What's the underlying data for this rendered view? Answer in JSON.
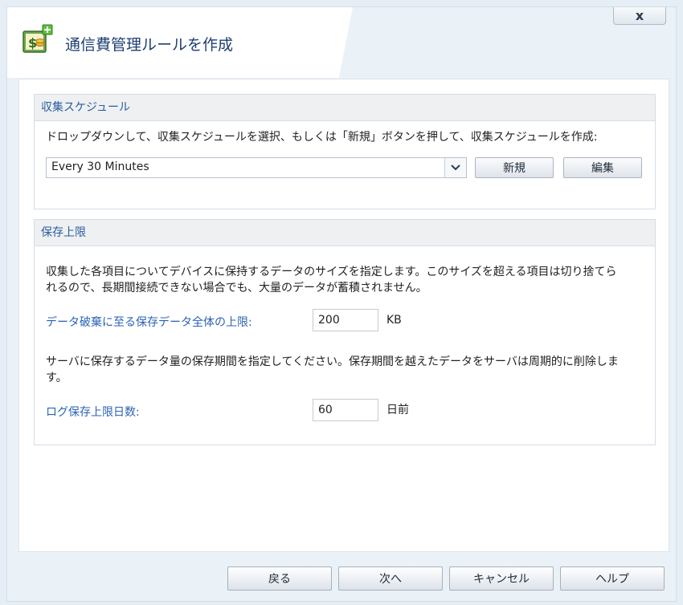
{
  "dialog": {
    "title": "通信費管理ルールを作成",
    "close_label": "x",
    "app_icon": "money-add-icon"
  },
  "schedule": {
    "header": "収集スケジュール",
    "description": "ドロップダウンして、収集スケジュールを選択、もしくは「新規」ボタンを押して、収集スケジュールを作成:",
    "selected": "Every 30 Minutes",
    "new_label": "新規",
    "edit_label": "編集"
  },
  "limits": {
    "header": "保存上限",
    "size_description_1": "収集した各項目についてデバイスに保持するデータのサイズを指定します。このサイズを超える項目は切り捨てら",
    "size_description_2": "れるので、長期間接続できない場合でも、大量のデータが蓄積されません。",
    "size_label": "データ破棄に至る保存データ全体の上限:",
    "size_value": "200",
    "size_unit": "KB",
    "retention_description_1": "サーバに保存するデータ量の保存期間を指定してください。保存期間を越えたデータをサーバは周期的に削除しま",
    "retention_description_2": "す。",
    "retention_label": "ログ保存上限日数:",
    "retention_value": "60",
    "retention_unit": "日前"
  },
  "footer": {
    "back_label": "戻る",
    "next_label": "次へ",
    "cancel_label": "キャンセル",
    "help_label": "ヘルプ"
  }
}
